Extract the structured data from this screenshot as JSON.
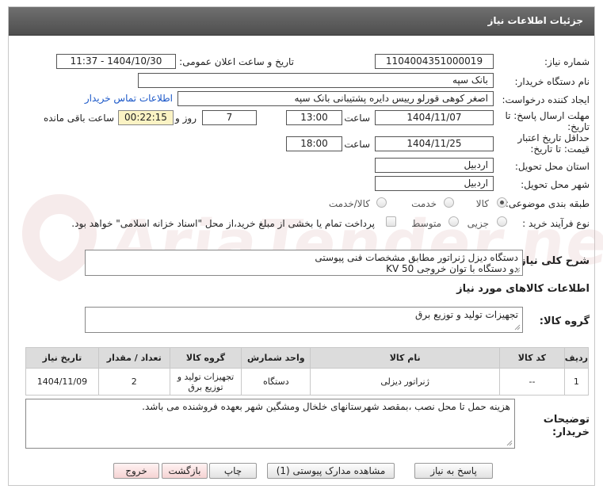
{
  "header": {
    "title": "جزئیات اطلاعات نیاز"
  },
  "labels": {
    "need_number": "شماره نیاز:",
    "announce_datetime": "تاریخ و ساعت اعلان عمومی:",
    "buyer_org": "نام دستگاه خریدار:",
    "creator": "ایجاد کننده درخواست:",
    "reply_deadline_1": "مهلت ارسال پاسخ: تا",
    "reply_deadline_2": "تاریخ:",
    "time": "ساعت",
    "day_and": "روز و",
    "remaining": "ساعت باقی مانده",
    "price_validity_1": "حداقل تاریخ اعتبار",
    "price_validity_2": "قیمت: تا تاریخ:",
    "province": "استان محل تحویل:",
    "city": "شهر محل تحویل:",
    "category": "طبقه بندی موضوعی:",
    "process_type": "نوع فرآیند خرید :",
    "description": "شرح کلی نیاز:",
    "goods_info": "اطلاعات کالاهای مورد نیاز",
    "goods_group": "گروه کالا:",
    "buyer_notes_1": "توضیحات",
    "buyer_notes_2": "خریدار:"
  },
  "values": {
    "need_number": "1104004351000019",
    "announce_datetime": "1404/10/30 - 11:37",
    "buyer_org": "بانک سپه",
    "creator": "اصغر کوهی قورلو رییس دایره پشتیبانی بانک سپه",
    "contact_link": "اطلاعات تماس خریدار",
    "reply_date": "1404/11/07",
    "reply_time": "13:00",
    "reply_days": "7",
    "remaining_time": "00:22:15",
    "validity_date": "1404/11/25",
    "validity_time": "18:00",
    "province": "اردبیل",
    "city": "اردبیل",
    "description_line1": "دستگاه دیزل ژنراتور مطابق مشخصات فنی پیوستی",
    "description_line2": "دو دستگاه با توان خروجی KV 50",
    "goods_group": "تجهیزات تولید و توزیع برق",
    "buyer_notes": "هزینه حمل تا محل نصب ،بمقصد شهرستانهای خلخال ومشگین شهر بعهده فروشنده می باشد."
  },
  "category_options": [
    {
      "label": "کالا",
      "selected": true
    },
    {
      "label": "خدمت",
      "selected": false
    },
    {
      "label": "کالا/خدمت",
      "selected": false
    }
  ],
  "process_options": [
    {
      "label": "جزیی",
      "selected": false
    },
    {
      "label": "متوسط",
      "selected": false
    }
  ],
  "treasury_note": "پرداخت تمام یا بخشی از مبلغ خرید،از محل \"اسناد خزانه اسلامی\" خواهد بود.",
  "table": {
    "headers": [
      "ردیف",
      "کد کالا",
      "نام کالا",
      "واحد شمارش",
      "گروه کالا",
      "تعداد / مقدار",
      "تاریخ نیاز"
    ],
    "rows": [
      [
        "1",
        "--",
        "ژنراتور دیزلی",
        "دستگاه",
        "تجهیزات تولید و توزیع برق",
        "2",
        "1404/11/09"
      ]
    ]
  },
  "buttons": {
    "reply": "پاسخ به نیاز",
    "view_docs": "مشاهده مدارک پیوستی (1)",
    "print": "چاپ",
    "back": "بازگشت",
    "exit": "خروج"
  },
  "watermark": "AriaTender.net",
  "colors": {
    "header_bg": "#5a5a5a",
    "link": "#1a57c8",
    "remaining_bg": "#fbf3c4",
    "table_header_bg": "#dcdcdc"
  }
}
